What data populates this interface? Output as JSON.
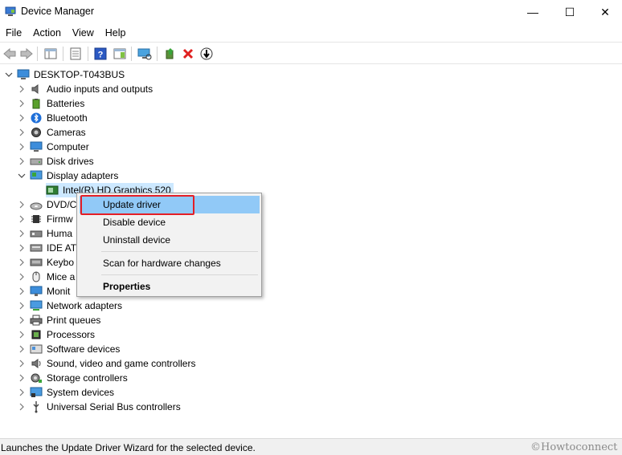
{
  "window": {
    "title": "Device Manager",
    "minimize_glyph": "—",
    "maximize_glyph": "☐",
    "close_glyph": "✕"
  },
  "menubar": {
    "items": [
      "File",
      "Action",
      "View",
      "Help"
    ]
  },
  "toolbar": {
    "icons": [
      "back-arrow-icon",
      "forward-arrow-icon",
      "show-hide-console-tree-icon",
      "properties-icon",
      "help-icon",
      "action-pane-icon",
      "scan-hardware-icon",
      "update-driver-icon",
      "uninstall-device-icon",
      "disable-device-icon"
    ]
  },
  "tree": {
    "root": "DESKTOP-T043BUS",
    "categories": [
      {
        "label": "Audio inputs and outputs",
        "icon": "speaker-icon"
      },
      {
        "label": "Batteries",
        "icon": "battery-icon"
      },
      {
        "label": "Bluetooth",
        "icon": "bluetooth-icon"
      },
      {
        "label": "Cameras",
        "icon": "camera-icon"
      },
      {
        "label": "Computer",
        "icon": "computer-icon"
      },
      {
        "label": "Disk drives",
        "icon": "disk-drive-icon"
      },
      {
        "label": "Display adapters",
        "icon": "display-adapter-icon",
        "expanded": true
      },
      {
        "label": "DVD/C",
        "icon": "dvd-icon"
      },
      {
        "label": "Firmw",
        "icon": "firmware-icon"
      },
      {
        "label": "Huma",
        "icon": "hid-icon"
      },
      {
        "label": "IDE AT",
        "icon": "ide-icon"
      },
      {
        "label": "Keybo",
        "icon": "keyboard-icon"
      },
      {
        "label": "Mice a",
        "icon": "mouse-icon"
      },
      {
        "label": "Monit",
        "icon": "monitor-icon"
      },
      {
        "label": "Network adapters",
        "icon": "network-adapter-icon"
      },
      {
        "label": "Print queues",
        "icon": "printer-icon"
      },
      {
        "label": "Processors",
        "icon": "processor-icon"
      },
      {
        "label": "Software devices",
        "icon": "software-device-icon"
      },
      {
        "label": "Sound, video and game controllers",
        "icon": "sound-icon"
      },
      {
        "label": "Storage controllers",
        "icon": "storage-controller-icon"
      },
      {
        "label": "System devices",
        "icon": "system-device-icon"
      },
      {
        "label": "Universal Serial Bus controllers",
        "icon": "usb-icon"
      }
    ],
    "child_device": "Intel(R) HD Graphics 520"
  },
  "context_menu": {
    "update_driver": "Update driver",
    "disable_device": "Disable device",
    "uninstall_device": "Uninstall device",
    "scan_changes": "Scan for hardware changes",
    "properties": "Properties"
  },
  "status": {
    "text": "Launches the Update Driver Wizard for the selected device.",
    "watermark": "©Howtoconnect"
  },
  "colors": {
    "selection": "#cce8ff",
    "menu_highlight": "#91c9f7",
    "annotation_red": "#e41e26"
  }
}
